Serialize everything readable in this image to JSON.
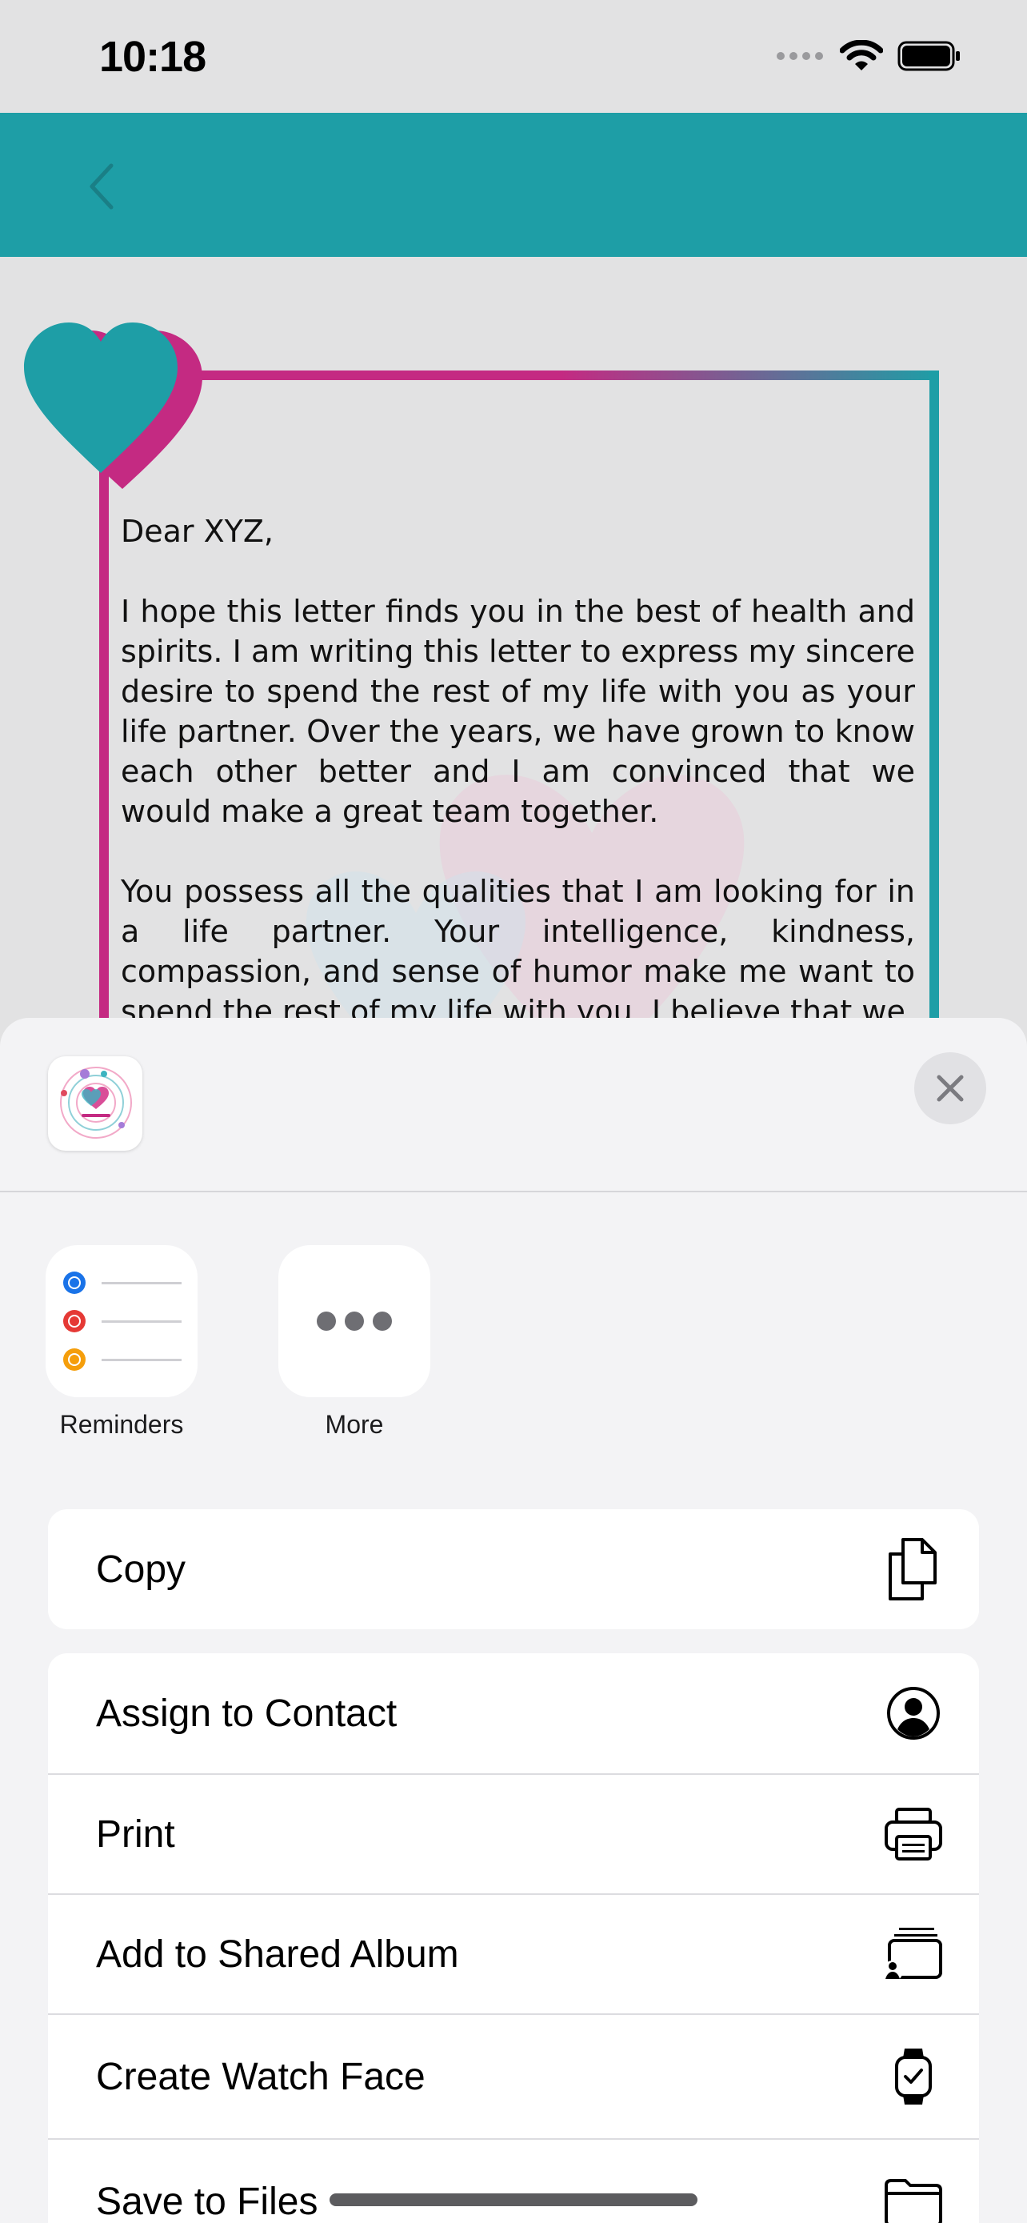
{
  "status": {
    "time": "10:18"
  },
  "letter": {
    "salutation": "Dear XYZ,",
    "paragraph1": "I hope this letter finds you in the best of health and spirits. I am writing this letter to express my sincere desire to spend the rest of my life with you as your life partner. Over the years, we have grown to know each other better and I am convinced that we would make a great team together.",
    "paragraph2": "You possess all the qualities that I am looking for in a life partner. Your intelligence, kindness, compassion, and sense of humor make me want to spend the rest of my life with you. I believe that we"
  },
  "share_sheet": {
    "apps": [
      {
        "label": "Reminders",
        "icon": "reminders-icon"
      },
      {
        "label": "More",
        "icon": "more-icon"
      }
    ],
    "copy": {
      "label": "Copy",
      "icon": "copy-icon"
    },
    "actions": [
      {
        "label": "Assign to Contact",
        "icon": "contact-icon"
      },
      {
        "label": "Print",
        "icon": "printer-icon"
      },
      {
        "label": "Add to Shared Album",
        "icon": "shared-album-icon"
      },
      {
        "label": "Create Watch Face",
        "icon": "watch-icon"
      },
      {
        "label": "Save to Files",
        "icon": "folder-icon"
      }
    ]
  },
  "colors": {
    "nav": "#1e9ea6",
    "heart_teal": "#1e9ea6",
    "heart_pink": "#c42a82",
    "sheet": "#f3f3f5"
  }
}
